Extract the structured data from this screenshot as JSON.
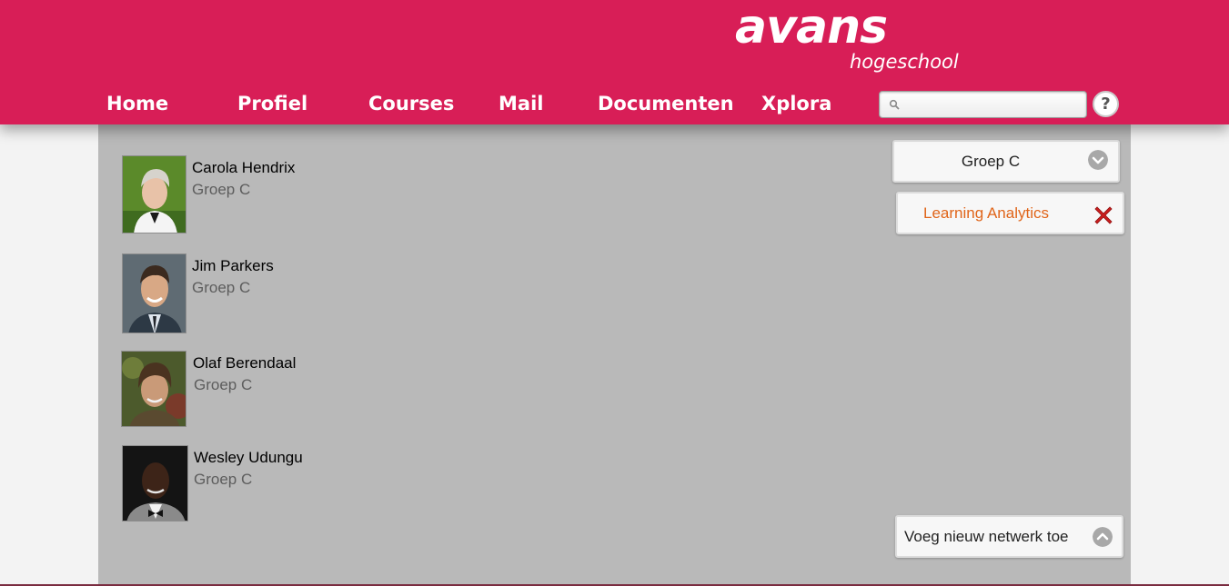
{
  "header": {
    "logo_main": "avans",
    "logo_sub": "hogeschool",
    "nav": [
      "Home",
      "Profiel",
      "Courses",
      "Mail",
      "Documenten",
      "Xplora"
    ],
    "search": {
      "value": "",
      "placeholder": ""
    },
    "help_label": "?"
  },
  "members": [
    {
      "name": "Carola Hendrix",
      "group": "Groep C"
    },
    {
      "name": "Jim Parkers",
      "group": "Groep C"
    },
    {
      "name": "Olaf Berendaal",
      "group": "Groep C"
    },
    {
      "name": "Wesley Udungu",
      "group": "Groep C"
    }
  ],
  "panel": {
    "group_select": "Groep C",
    "analytics_tag": "Learning Analytics",
    "add_network": "Voeg nieuw netwerk toe"
  },
  "colors": {
    "brand": "#d81e57",
    "panel_bg": "#b9b9b9",
    "accent_text": "#e0651a",
    "close": "#cc1f1f"
  },
  "icons": [
    "search-icon",
    "help-icon",
    "chevron-down-icon",
    "close-icon",
    "chevron-up-icon"
  ]
}
